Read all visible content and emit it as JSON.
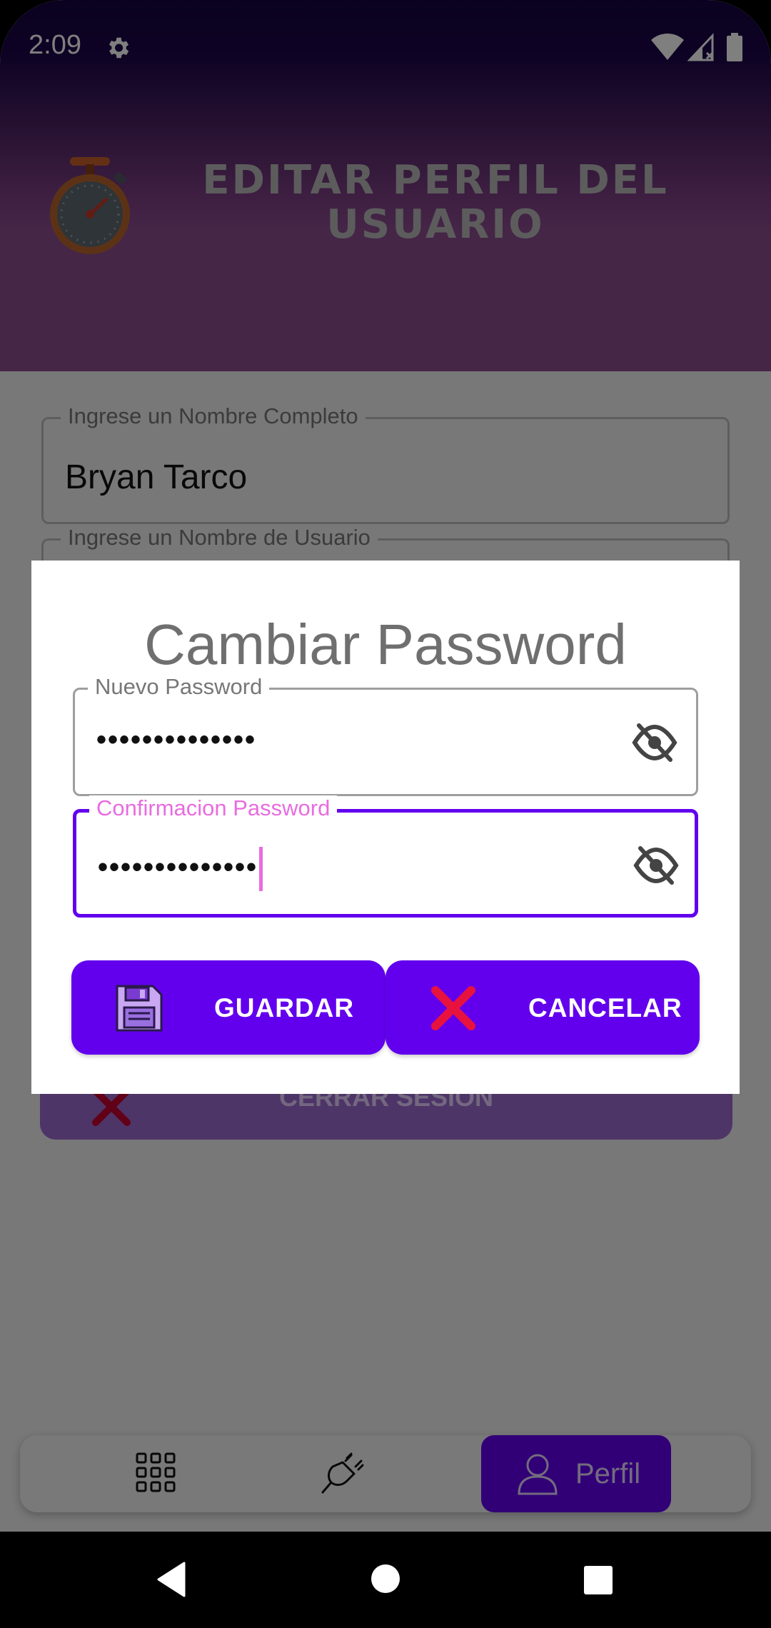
{
  "status_bar": {
    "time": "2:09"
  },
  "header": {
    "title": "EDITAR PERFIL DEL USUARIO"
  },
  "form": {
    "full_name": {
      "label": "Ingrese un Nombre Completo",
      "value": "Bryan Tarco"
    },
    "username": {
      "label": "Ingrese un Nombre de Usuario"
    }
  },
  "logout": {
    "label": "CERRAR SESION"
  },
  "dialog": {
    "title": "Cambiar Password",
    "new_password": {
      "label": "Nuevo Password",
      "value": "••••••••••••••"
    },
    "confirm_password": {
      "label": "Confirmacion Password",
      "value": "••••••••••••••"
    },
    "save_label": "GUARDAR",
    "cancel_label": "CANCELAR"
  },
  "bottom_nav": {
    "active_label": "Perfil"
  },
  "colors": {
    "primary": "#6200ee",
    "focus_label": "#e86ce0",
    "header_dark": "#16023f"
  }
}
